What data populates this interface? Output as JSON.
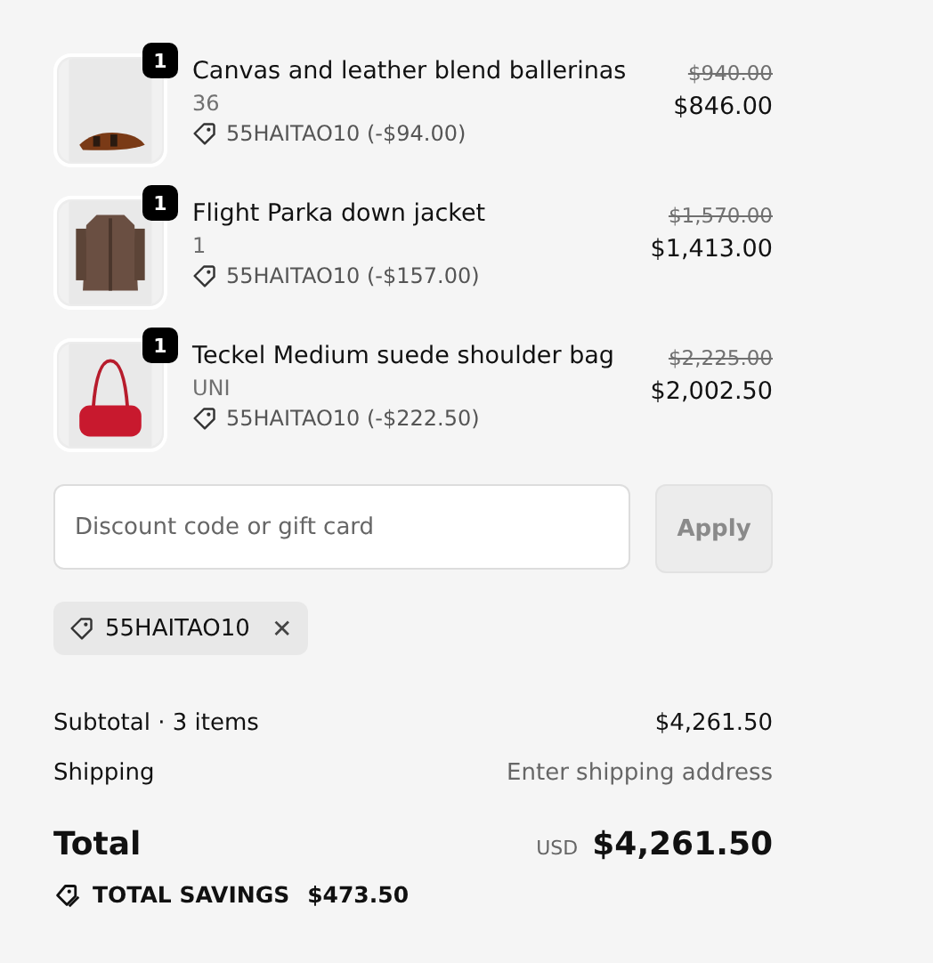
{
  "items": [
    {
      "quantity": "1",
      "title": "Canvas and leather blend ballerinas",
      "variant": "36",
      "discount": "55HAITAO10 (-$94.00)",
      "original_price": "$940.00",
      "price": "$846.00"
    },
    {
      "quantity": "1",
      "title": "Flight Parka down jacket",
      "variant": "1",
      "discount": "55HAITAO10 (-$157.00)",
      "original_price": "$1,570.00",
      "price": "$1,413.00"
    },
    {
      "quantity": "1",
      "title": "Teckel Medium suede shoulder bag",
      "variant": "UNI",
      "discount": "55HAITAO10 (-$222.50)",
      "original_price": "$2,225.00",
      "price": "$2,002.50"
    }
  ],
  "discount_field": {
    "placeholder": "Discount code or gift card"
  },
  "apply_button": {
    "label": "Apply",
    "disabled": true
  },
  "applied_code": {
    "code": "55HAITAO10",
    "remove": "✕"
  },
  "summary": [
    {
      "label": "Subtotal · 3 items",
      "value": "$4,261.50",
      "kind": "amount"
    },
    {
      "label": "Shipping",
      "value": "Enter shipping address",
      "kind": "hint"
    }
  ],
  "total": {
    "label": "Total",
    "currency": "USD",
    "value": "$4,261.50"
  },
  "savings": {
    "label": "TOTAL SAVINGS",
    "value": "$473.50"
  }
}
